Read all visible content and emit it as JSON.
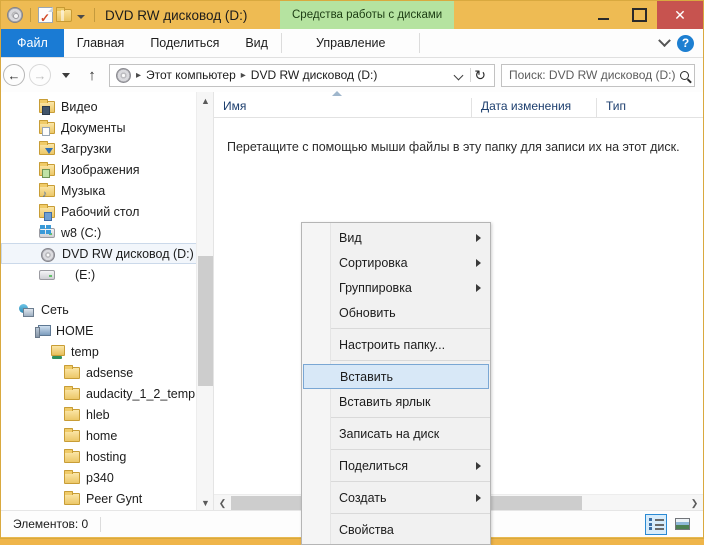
{
  "window": {
    "title": "DVD RW дисковод (D:)",
    "contextual_tab_banner": "Средства работы с дисками",
    "accent_titlebar_color": "#eebb53",
    "contextual_tab_color": "#b5e3a0",
    "close_button_color": "#c7534f",
    "controls": {
      "minimize": "—",
      "maximize": "□",
      "close": "✕"
    },
    "quick_access": {
      "cd_icon": "cd-icon",
      "properties_icon": "properties-icon",
      "new-folder_icon": "new-folder-icon",
      "customize_icon": "chevron-down-icon"
    }
  },
  "ribbon": {
    "tabs": [
      {
        "label": "Файл",
        "active": true
      },
      {
        "label": "Главная",
        "active": false
      },
      {
        "label": "Поделиться",
        "active": false
      },
      {
        "label": "Вид",
        "active": false
      },
      {
        "label": "Управление",
        "active": false
      }
    ],
    "expand_icon": "chevron-down-icon",
    "help_label": "?"
  },
  "navbar": {
    "back_icon": "←",
    "forward_icon": "→",
    "recent_icon": "chevron-down-icon",
    "up_icon": "↑",
    "address": {
      "drive_icon": "cd-icon",
      "crumbs": [
        "Этот компьютер",
        "DVD RW дисковод (D:)"
      ],
      "separator": "▸",
      "dropdown_icon": "chevron-down-icon",
      "refresh_icon": "↻"
    },
    "search": {
      "placeholder": "Поиск: DVD RW дисковод (D:)",
      "value": "",
      "icon": "search-icon"
    }
  },
  "navpane": {
    "libraries": [
      {
        "label": "Видео",
        "icon": "folder-video-icon",
        "selected": false
      },
      {
        "label": "Документы",
        "icon": "folder-documents-icon",
        "selected": false
      },
      {
        "label": "Загрузки",
        "icon": "folder-downloads-icon",
        "selected": false
      },
      {
        "label": "Изображения",
        "icon": "folder-pictures-icon",
        "selected": false
      },
      {
        "label": "Музыка",
        "icon": "folder-music-icon",
        "selected": false
      },
      {
        "label": "Рабочий стол",
        "icon": "folder-desktop-icon",
        "selected": false
      },
      {
        "label": "w8 (C:)",
        "icon": "drive-windows-icon",
        "selected": false
      },
      {
        "label": "DVD RW дисковод (D:)",
        "icon": "cd-drive-icon",
        "selected": true
      },
      {
        "label": "(E:)",
        "icon": "drive-icon",
        "selected": false
      }
    ],
    "network": [
      {
        "label": "Сеть",
        "icon": "network-icon",
        "indent": 0
      },
      {
        "label": "HOME",
        "icon": "computer-icon",
        "indent": 1
      },
      {
        "label": "temp",
        "icon": "shared-folder-icon",
        "indent": 2
      },
      {
        "label": "adsense",
        "icon": "folder-icon",
        "indent": 3
      },
      {
        "label": "audacity_1_2_temp",
        "icon": "folder-icon",
        "indent": 3
      },
      {
        "label": "hleb",
        "icon": "folder-icon",
        "indent": 3
      },
      {
        "label": "home",
        "icon": "folder-icon",
        "indent": 3
      },
      {
        "label": "hosting",
        "icon": "folder-icon",
        "indent": 3
      },
      {
        "label": "p340",
        "icon": "folder-icon",
        "indent": 3
      },
      {
        "label": "Peer Gynt",
        "icon": "folder-icon",
        "indent": 3
      }
    ],
    "scroll_up_icon": "chevron-up-icon",
    "scroll_down_icon": "chevron-down-icon"
  },
  "filelist": {
    "columns": [
      "Имя",
      "Дата изменения",
      "Тип"
    ],
    "sort_indicator": "ascending",
    "empty_message": "Перетащите с помощью мыши файлы в эту папку для записи их на этот диск.",
    "scroll_left_icon": "❮",
    "scroll_right_icon": "❯"
  },
  "contextmenu": {
    "items": [
      {
        "label": "Вид",
        "submenu": true,
        "highlighted": false,
        "separator_after": false
      },
      {
        "label": "Сортировка",
        "submenu": true,
        "highlighted": false,
        "separator_after": false
      },
      {
        "label": "Группировка",
        "submenu": true,
        "highlighted": false,
        "separator_after": false
      },
      {
        "label": "Обновить",
        "submenu": false,
        "highlighted": false,
        "separator_after": true
      },
      {
        "label": "Настроить папку...",
        "submenu": false,
        "highlighted": false,
        "separator_after": true
      },
      {
        "label": "Вставить",
        "submenu": false,
        "highlighted": true,
        "separator_after": false
      },
      {
        "label": "Вставить ярлык",
        "submenu": false,
        "highlighted": false,
        "separator_after": true
      },
      {
        "label": "Записать на диск",
        "submenu": false,
        "highlighted": false,
        "separator_after": true
      },
      {
        "label": "Поделиться",
        "submenu": true,
        "highlighted": false,
        "separator_after": true
      },
      {
        "label": "Создать",
        "submenu": true,
        "highlighted": false,
        "separator_after": true
      },
      {
        "label": "Свойства",
        "submenu": false,
        "highlighted": false,
        "separator_after": false
      }
    ],
    "highlight_color": "#d8e8f7",
    "highlight_border_color": "#7aa7d4"
  },
  "statusbar": {
    "item_count_text": "Элементов: 0",
    "view_details_icon": "details-view-icon",
    "view_tiles_icon": "large-icons-view-icon",
    "active_view": "details"
  }
}
